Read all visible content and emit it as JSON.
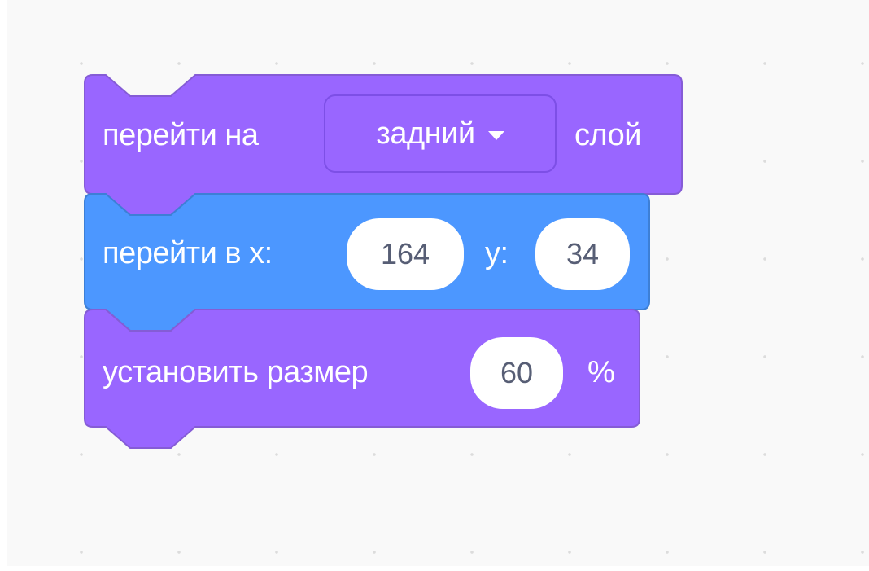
{
  "workspace": {
    "background_color": "#f9f9f9",
    "dot_color": "#dcdcdc"
  },
  "blocks": [
    {
      "category": "looks",
      "color": "#9966ff",
      "prefix": "перейти на",
      "dropdown_value": "задний",
      "suffix": "слой"
    },
    {
      "category": "motion",
      "color": "#4c97ff",
      "prefix": "перейти в х:",
      "x_value": "164",
      "y_label": "y:",
      "y_value": "34"
    },
    {
      "category": "looks",
      "color": "#9966ff",
      "prefix": "установить размер",
      "size_value": "60",
      "suffix": "%"
    }
  ]
}
